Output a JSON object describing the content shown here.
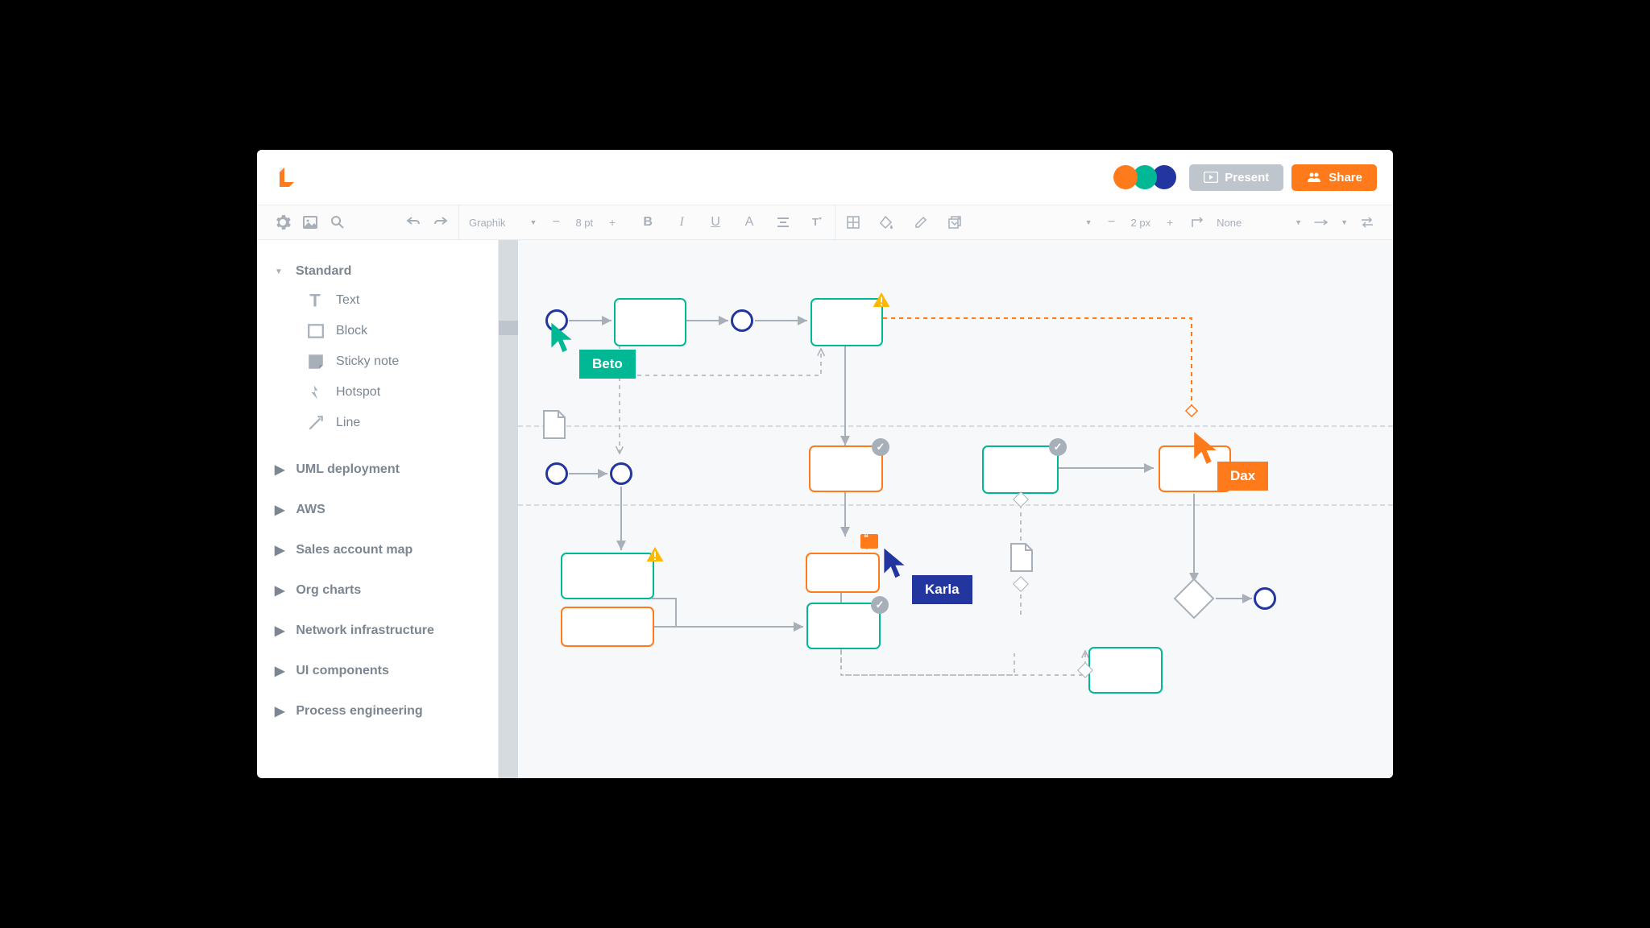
{
  "header": {
    "present_label": "Present",
    "share_label": "Share",
    "avatar_colors": [
      "#FF7A1A",
      "#00B894",
      "#2336A0"
    ]
  },
  "toolbar": {
    "font_family": "Graphik",
    "font_size": "8 pt",
    "stroke_width": "2 px",
    "line_style": "None"
  },
  "sidebar": {
    "expanded_category": "Standard",
    "items": [
      {
        "label": "Text"
      },
      {
        "label": "Block"
      },
      {
        "label": "Sticky note"
      },
      {
        "label": "Hotspot"
      },
      {
        "label": "Line"
      }
    ],
    "categories": [
      "UML deployment",
      "AWS",
      "Sales account map",
      "Org charts",
      "Network infrastructure",
      "UI components",
      "Process engineering"
    ]
  },
  "canvas": {
    "collaborators": [
      {
        "name": "Beto",
        "color": "#00B894"
      },
      {
        "name": "Karla",
        "color": "#2336A0"
      },
      {
        "name": "Dax",
        "color": "#FF7A1A"
      }
    ]
  }
}
